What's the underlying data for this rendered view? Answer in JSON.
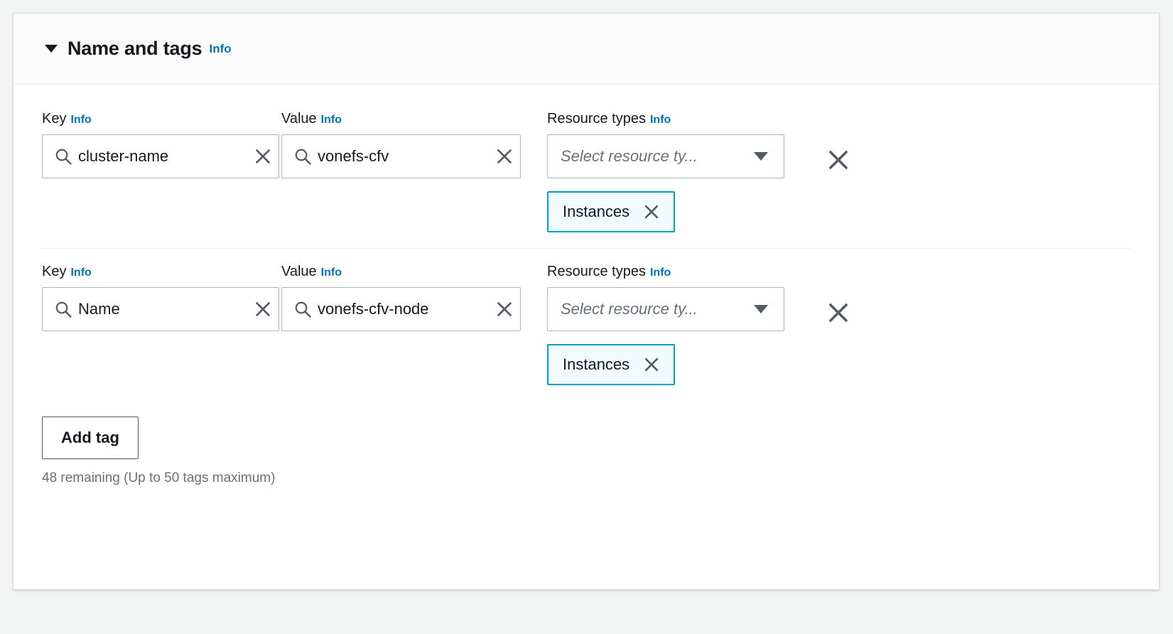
{
  "panel": {
    "title": "Name and tags",
    "info_label": "Info",
    "expanded": true,
    "caret_icon": "caret-down-icon"
  },
  "labels": {
    "key": "Key",
    "value": "Value",
    "resource_types": "Resource types",
    "info": "Info"
  },
  "tags": [
    {
      "key": "cluster-name",
      "value": "vonefs-cfv",
      "resource_types_placeholder": "Select resource ty...",
      "selected_resource_types": [
        "Instances"
      ]
    },
    {
      "key": "Name",
      "value": "vonefs-cfv-node",
      "resource_types_placeholder": "Select resource ty...",
      "selected_resource_types": [
        "Instances"
      ]
    }
  ],
  "actions": {
    "add_tag_label": "Add tag",
    "remaining_text": "48 remaining (Up to 50 tags maximum)"
  },
  "colors": {
    "link_blue": "#0073bb",
    "token_border": "#00a1c9",
    "token_background": "#f1faff",
    "input_border": "#aab7b8",
    "panel_border": "#d5dbdb",
    "header_background": "#fafafa",
    "page_background": "#f2f3f3",
    "text_primary": "#16191f",
    "text_secondary": "#687078"
  }
}
